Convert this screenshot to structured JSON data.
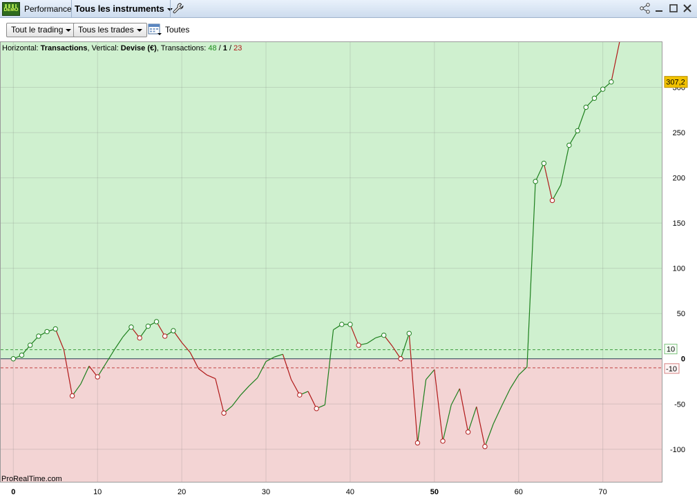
{
  "titlebar": {
    "demo_badge": "DEMO",
    "tab_performance": "Performance",
    "tab_instruments": "Tous les instruments"
  },
  "toolbar": {
    "trading_select": "Tout le trading",
    "trades_select": "Tous les trades",
    "period_label": "Toutes"
  },
  "legend": {
    "h_label": "Horizontal: ",
    "h_value": "Transactions",
    "v_label": ", Vertical: ",
    "v_value": "Devise (€)",
    "t_label": ", Transactions: ",
    "wins": "48",
    "sep1": " / ",
    "neutral": "1",
    "sep2": " / ",
    "losses": "23"
  },
  "watermark": "ProRealTime.com",
  "colors": {
    "positive_zone": "#cff0cf",
    "negative_zone": "#f3d4d4",
    "up_line": "#1c7f1c",
    "down_line": "#b01818",
    "last_value_badge": "#f2c200"
  },
  "chart_data": {
    "type": "line",
    "xlabel": "Transactions",
    "ylabel": "Devise (€)",
    "xlim": [
      -1.5,
      77
    ],
    "ylim": [
      -136,
      350
    ],
    "x_ticks": [
      0,
      10,
      20,
      30,
      40,
      50,
      60,
      70
    ],
    "x_tick_labels": [
      "0",
      "10",
      "20",
      "30",
      "40",
      "50",
      "60",
      "70"
    ],
    "y_ticks": [
      -100,
      -50,
      0,
      50,
      100,
      150,
      200,
      250,
      300
    ],
    "y_tick_labels": [
      "-100",
      "-50",
      "0",
      "50",
      "100",
      "150",
      "200",
      "250",
      "300"
    ],
    "threshold_upper": 10,
    "threshold_lower": -10,
    "threshold_upper_label": "10",
    "threshold_lower_label": "-10",
    "last_value_label": "307,2",
    "grid": true,
    "x": [
      0,
      1,
      2,
      3,
      4,
      5,
      6,
      7,
      8,
      9,
      10,
      11,
      12,
      13,
      14,
      15,
      16,
      17,
      18,
      19,
      20,
      21,
      22,
      23,
      24,
      25,
      26,
      27,
      28,
      29,
      30,
      31,
      32,
      33,
      34,
      35,
      36,
      37,
      38,
      39,
      40,
      41,
      42,
      43,
      44,
      45,
      46,
      47,
      48,
      49,
      50,
      51,
      52,
      53,
      54,
      55,
      56,
      57,
      58,
      59,
      60,
      61,
      62,
      63,
      64,
      65,
      66,
      67,
      68,
      69,
      70,
      71,
      72
    ],
    "values": [
      0,
      4,
      15,
      25,
      30,
      33,
      10,
      -41,
      -28,
      -8,
      -20,
      -5,
      10,
      24,
      35,
      23,
      36,
      41,
      25,
      31,
      18,
      7,
      -11,
      -18,
      -22,
      -60,
      -52,
      -40,
      -30,
      -21,
      -3,
      2,
      5,
      -23,
      -40,
      -36,
      -55,
      -51,
      32,
      38,
      38,
      15,
      17,
      23,
      26,
      14,
      0,
      28,
      -93,
      -23,
      -12,
      -91,
      -51,
      -33,
      -81,
      -53,
      -97,
      -72,
      -52,
      -33,
      -18,
      -9,
      196,
      216,
      175,
      192,
      236,
      252,
      278,
      288,
      298,
      306
    ]
  }
}
